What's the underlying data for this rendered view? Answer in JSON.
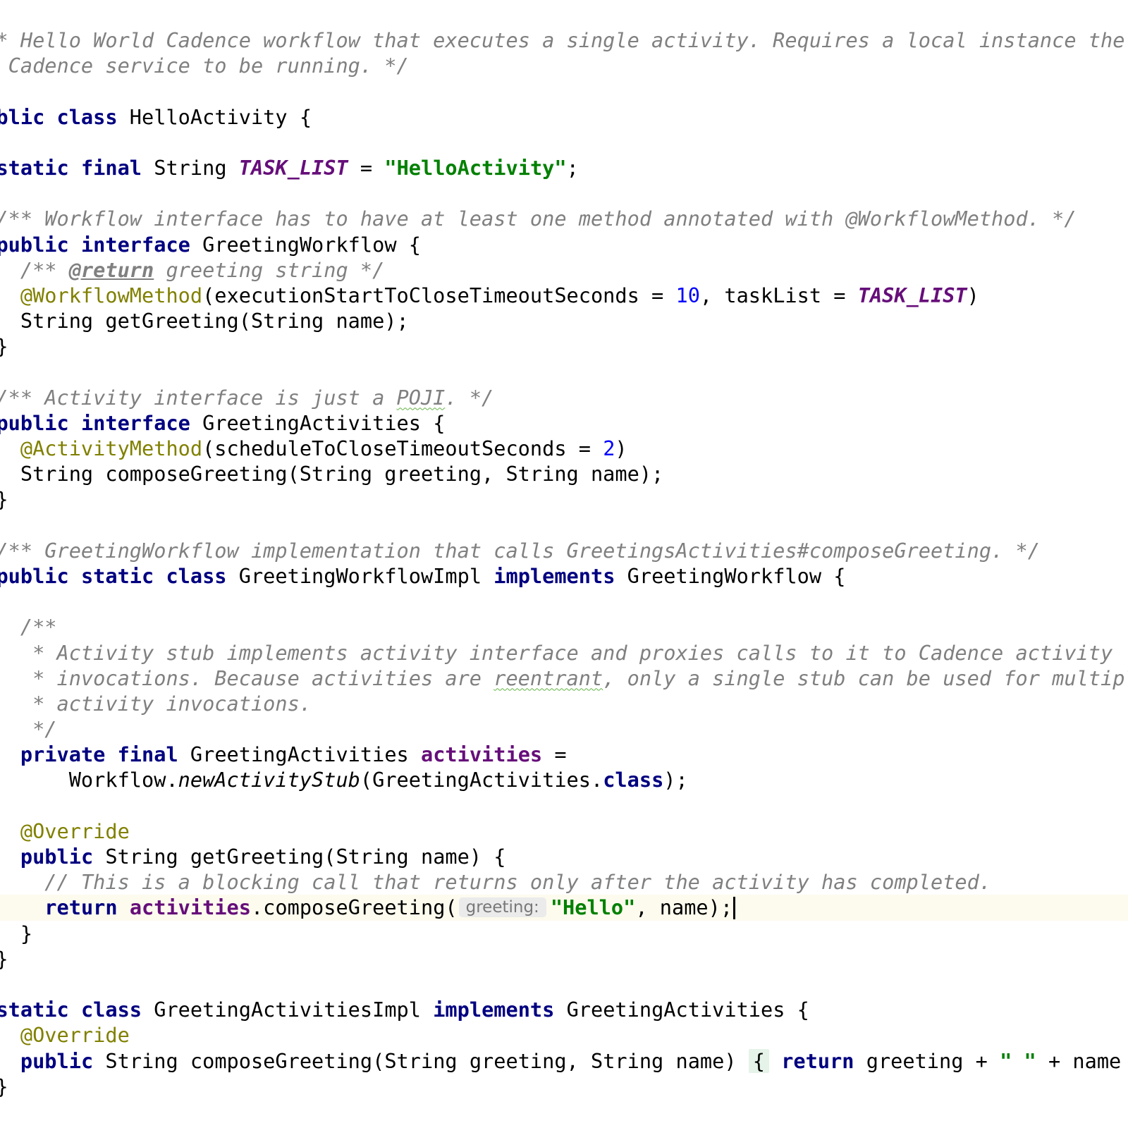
{
  "editor": {
    "language": "Java",
    "colors": {
      "background": "#ffffff",
      "keyword": "#000080",
      "comment": "#808080",
      "string": "#008000",
      "number": "#0000ff",
      "annotation": "#808000",
      "constant_field": "#660e7a",
      "current_line": "#fdfbee"
    },
    "lines": [
      [
        {
          "c": "cm",
          "t": "/** Hello World Cadence workflow that executes a single activity. Requires a local instance the"
        }
      ],
      [
        {
          "c": "cm",
          "t": " * Cadence service to be running. */"
        }
      ],
      [
        {
          "c": "",
          "t": ""
        }
      ],
      [
        {
          "c": "kw",
          "t": "public class"
        },
        {
          "c": "",
          "t": " HelloActivity {"
        }
      ],
      [
        {
          "c": "",
          "t": ""
        }
      ],
      [
        {
          "c": "",
          "t": "  "
        },
        {
          "c": "kw",
          "t": "static final"
        },
        {
          "c": "",
          "t": " String "
        },
        {
          "c": "cst",
          "t": "TASK_LIST"
        },
        {
          "c": "",
          "t": " = "
        },
        {
          "c": "str",
          "t": "\"HelloActivity\""
        },
        {
          "c": "",
          "t": ";"
        }
      ],
      [
        {
          "c": "",
          "t": ""
        }
      ],
      [
        {
          "c": "cm",
          "t": "  /** Workflow interface has to have at least one method annotated with @WorkflowMethod. */"
        }
      ],
      [
        {
          "c": "",
          "t": "  "
        },
        {
          "c": "kw",
          "t": "public interface"
        },
        {
          "c": "",
          "t": " GreetingWorkflow {"
        }
      ],
      [
        {
          "c": "cm",
          "t": "    /** "
        },
        {
          "c": "dtag",
          "t": "@return"
        },
        {
          "c": "cm",
          "t": " greeting string */"
        }
      ],
      [
        {
          "c": "ann",
          "t": "    @WorkflowMethod"
        },
        {
          "c": "",
          "t": "(executionStartToCloseTimeoutSeconds = "
        },
        {
          "c": "num",
          "t": "10"
        },
        {
          "c": "",
          "t": ", taskList = "
        },
        {
          "c": "cst",
          "t": "TASK_LIST"
        },
        {
          "c": "",
          "t": ")"
        }
      ],
      [
        {
          "c": "",
          "t": "    String getGreeting(String name);"
        }
      ],
      [
        {
          "c": "",
          "t": "  }"
        }
      ],
      [
        {
          "c": "",
          "t": ""
        }
      ],
      [
        {
          "c": "cm",
          "t": "  /** Activity interface is just a "
        },
        {
          "c": "cm typo",
          "t": "POJI"
        },
        {
          "c": "cm",
          "t": ". */"
        }
      ],
      [
        {
          "c": "",
          "t": "  "
        },
        {
          "c": "kw",
          "t": "public interface"
        },
        {
          "c": "",
          "t": " GreetingActivities {"
        }
      ],
      [
        {
          "c": "ann",
          "t": "    @ActivityMethod"
        },
        {
          "c": "",
          "t": "(scheduleToCloseTimeoutSeconds = "
        },
        {
          "c": "num",
          "t": "2"
        },
        {
          "c": "",
          "t": ")"
        }
      ],
      [
        {
          "c": "",
          "t": "    String composeGreeting(String greeting, String name);"
        }
      ],
      [
        {
          "c": "",
          "t": "  }"
        }
      ],
      [
        {
          "c": "",
          "t": ""
        }
      ],
      [
        {
          "c": "cm",
          "t": "  /** GreetingWorkflow implementation that calls GreetingsActivities#composeGreeting. */"
        }
      ],
      [
        {
          "c": "",
          "t": "  "
        },
        {
          "c": "kw",
          "t": "public static class"
        },
        {
          "c": "",
          "t": " GreetingWorkflowImpl "
        },
        {
          "c": "kw",
          "t": "implements"
        },
        {
          "c": "",
          "t": " GreetingWorkflow {"
        }
      ],
      [
        {
          "c": "",
          "t": ""
        }
      ],
      [
        {
          "c": "cm",
          "t": "    /**"
        }
      ],
      [
        {
          "c": "cm",
          "t": "     * Activity stub implements activity interface and proxies calls to it to Cadence activity"
        }
      ],
      [
        {
          "c": "cm",
          "t": "     * invocations. Because activities are "
        },
        {
          "c": "cm typo",
          "t": "reentrant"
        },
        {
          "c": "cm",
          "t": ", only a single stub can be used for multiple"
        }
      ],
      [
        {
          "c": "cm",
          "t": "     * activity invocations."
        }
      ],
      [
        {
          "c": "cm",
          "t": "     */"
        }
      ],
      [
        {
          "c": "",
          "t": "    "
        },
        {
          "c": "kw",
          "t": "private final"
        },
        {
          "c": "",
          "t": " GreetingActivities "
        },
        {
          "c": "fld",
          "t": "activities"
        },
        {
          "c": "",
          "t": " ="
        }
      ],
      [
        {
          "c": "",
          "t": "        Workflow."
        },
        {
          "c": "sm",
          "t": "newActivityStub"
        },
        {
          "c": "",
          "t": "(GreetingActivities."
        },
        {
          "c": "kw",
          "t": "class"
        },
        {
          "c": "",
          "t": ");"
        }
      ],
      [
        {
          "c": "",
          "t": ""
        }
      ],
      [
        {
          "c": "ann",
          "t": "    @Override"
        }
      ],
      [
        {
          "c": "",
          "t": "    "
        },
        {
          "c": "kw",
          "t": "public"
        },
        {
          "c": "",
          "t": " String getGreeting(String name) {"
        }
      ],
      [
        {
          "c": "cm",
          "t": "      // This is a blocking call that returns only after the activity has completed."
        }
      ],
      [
        {
          "c": "",
          "t": "      "
        },
        {
          "c": "kw",
          "t": "return"
        },
        {
          "c": "",
          "t": " "
        },
        {
          "c": "fld",
          "t": "activities"
        },
        {
          "c": "",
          "t": ".composeGreeting("
        },
        {
          "c": "hint",
          "t": "greeting:"
        },
        {
          "c": "str",
          "t": "\"Hello\""
        },
        {
          "c": "",
          "t": ", name);"
        },
        {
          "c": "caret",
          "t": ""
        }
      ],
      [
        {
          "c": "",
          "t": "    }"
        }
      ],
      [
        {
          "c": "",
          "t": "  }"
        }
      ],
      [
        {
          "c": "",
          "t": ""
        }
      ],
      [
        {
          "c": "",
          "t": "  "
        },
        {
          "c": "kw",
          "t": "static class"
        },
        {
          "c": "",
          "t": " GreetingActivitiesImpl "
        },
        {
          "c": "kw",
          "t": "implements"
        },
        {
          "c": "",
          "t": " GreetingActivities {"
        }
      ],
      [
        {
          "c": "ann",
          "t": "    @Override"
        }
      ],
      [
        {
          "c": "",
          "t": "    "
        },
        {
          "c": "kw",
          "t": "public"
        },
        {
          "c": "",
          "t": " String composeGreeting(String greeting, String name) "
        },
        {
          "c": "brace",
          "t": "{"
        },
        {
          "c": "",
          "t": " "
        },
        {
          "c": "kw",
          "t": "return"
        },
        {
          "c": "",
          "t": " greeting + "
        },
        {
          "c": "str",
          "t": "\" \""
        },
        {
          "c": "",
          "t": " + name + "
        },
        {
          "c": "str",
          "t": "\"!\""
        },
        {
          "c": "",
          "t": "; }"
        }
      ],
      [
        {
          "c": "",
          "t": "  }"
        }
      ]
    ]
  }
}
